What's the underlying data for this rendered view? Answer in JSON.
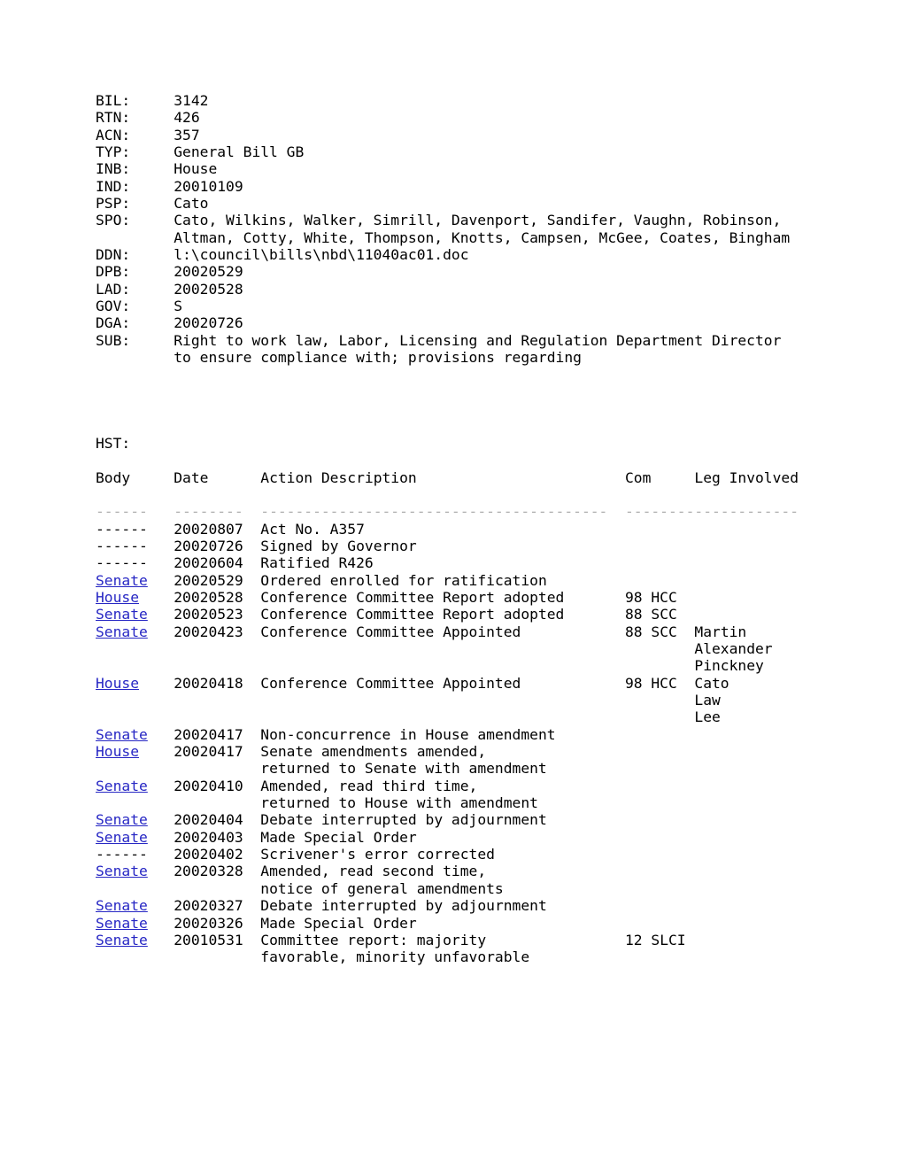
{
  "document": {
    "type": "legislative-bill-status-record",
    "fields": [
      {
        "key": "BIL:",
        "value": "3142"
      },
      {
        "key": "RTN:",
        "value": "426"
      },
      {
        "key": "ACN:",
        "value": "357"
      },
      {
        "key": "TYP:",
        "value": "General Bill GB"
      },
      {
        "key": "INB:",
        "value": "House"
      },
      {
        "key": "IND:",
        "value": "20010109"
      },
      {
        "key": "PSP:",
        "value": "Cato"
      },
      {
        "key": "SPO:",
        "value": "Cato, Wilkins, Walker, Simrill, Davenport, Sandifer, Vaughn, Robinson,",
        "value_cont": "Altman, Cotty, White, Thompson, Knotts, Campsen, McGee, Coates, Bingham"
      },
      {
        "key": "DDN:",
        "value": "l:\\council\\bills\\nbd\\11040ac01.doc"
      },
      {
        "key": "DPB:",
        "value": "20020529"
      },
      {
        "key": "LAD:",
        "value": "20020528"
      },
      {
        "key": "GOV:",
        "value": "S"
      },
      {
        "key": "DGA:",
        "value": "20020726"
      },
      {
        "key": "SUB:",
        "value": "Right to work law, Labor, Licensing and Regulation Department Director",
        "value_cont": "to ensure compliance with; provisions regarding"
      }
    ],
    "history_label": "HST:",
    "history_columns": {
      "body": "Body",
      "date": "Date",
      "action": "Action Description",
      "com": "Com",
      "leg": "Leg Involved"
    },
    "history_rules": {
      "body": "------",
      "date": "--------",
      "action": "----------------------------------------",
      "com": "--------",
      "leg": "------------"
    },
    "no_body_marker": "------",
    "history_rows": [
      {
        "body": "------",
        "is_link": false,
        "date": "20020807",
        "action": [
          "Act No. A357"
        ],
        "com": "",
        "leg": []
      },
      {
        "body": "------",
        "is_link": false,
        "date": "20020726",
        "action": [
          "Signed by Governor"
        ],
        "com": "",
        "leg": []
      },
      {
        "body": "------",
        "is_link": false,
        "date": "20020604",
        "action": [
          "Ratified R426"
        ],
        "com": "",
        "leg": []
      },
      {
        "body": "Senate",
        "is_link": true,
        "date": "20020529",
        "action": [
          "Ordered enrolled for ratification"
        ],
        "com": "",
        "leg": []
      },
      {
        "body": "House",
        "is_link": true,
        "date": "20020528",
        "action": [
          "Conference Committee Report adopted"
        ],
        "com": "98 HCC",
        "leg": []
      },
      {
        "body": "Senate",
        "is_link": true,
        "date": "20020523",
        "action": [
          "Conference Committee Report adopted"
        ],
        "com": "88 SCC",
        "leg": []
      },
      {
        "body": "Senate",
        "is_link": true,
        "date": "20020423",
        "action": [
          "Conference Committee Appointed"
        ],
        "com": "88 SCC",
        "leg": [
          "Martin",
          "Alexander",
          "Pinckney"
        ]
      },
      {
        "body": "House",
        "is_link": true,
        "date": "20020418",
        "action": [
          "Conference Committee Appointed"
        ],
        "com": "98 HCC",
        "leg": [
          "Cato",
          "Law",
          "Lee"
        ]
      },
      {
        "body": "Senate",
        "is_link": true,
        "date": "20020417",
        "action": [
          "Non-concurrence in House amendment"
        ],
        "com": "",
        "leg": []
      },
      {
        "body": "House",
        "is_link": true,
        "date": "20020417",
        "action": [
          "Senate amendments amended,",
          "returned to Senate with amendment"
        ],
        "com": "",
        "leg": []
      },
      {
        "body": "Senate",
        "is_link": true,
        "date": "20020410",
        "action": [
          "Amended, read third time,",
          "returned to House with amendment"
        ],
        "com": "",
        "leg": []
      },
      {
        "body": "Senate",
        "is_link": true,
        "date": "20020404",
        "action": [
          "Debate interrupted by adjournment"
        ],
        "com": "",
        "leg": []
      },
      {
        "body": "Senate",
        "is_link": true,
        "date": "20020403",
        "action": [
          "Made Special Order"
        ],
        "com": "",
        "leg": []
      },
      {
        "body": "------",
        "is_link": false,
        "date": "20020402",
        "action": [
          "Scrivener's error corrected"
        ],
        "com": "",
        "leg": []
      },
      {
        "body": "Senate",
        "is_link": true,
        "date": "20020328",
        "action": [
          "Amended, read second time,",
          "notice of general amendments"
        ],
        "com": "",
        "leg": []
      },
      {
        "body": "Senate",
        "is_link": true,
        "date": "20020327",
        "action": [
          "Debate interrupted by adjournment"
        ],
        "com": "",
        "leg": []
      },
      {
        "body": "Senate",
        "is_link": true,
        "date": "20020326",
        "action": [
          "Made Special Order"
        ],
        "com": "",
        "leg": []
      },
      {
        "body": "Senate",
        "is_link": true,
        "date": "20010531",
        "action": [
          "Committee report: majority",
          "favorable, minority unfavorable"
        ],
        "com": "12 SLCI",
        "leg": []
      }
    ]
  },
  "colors": {
    "text": "#000000",
    "link": "#2727c4",
    "rule": "#b0b0b0",
    "background": "#ffffff"
  }
}
